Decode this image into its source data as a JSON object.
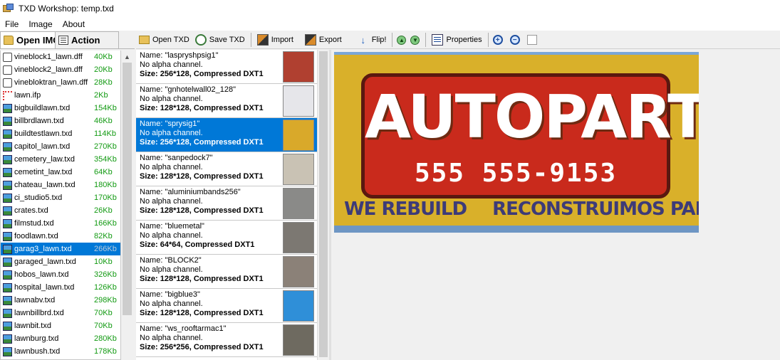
{
  "window": {
    "title": "TXD Workshop: temp.txd"
  },
  "menu": [
    "File",
    "Image",
    "About"
  ],
  "left_tabs": {
    "open": "Open IMG",
    "action": "Action"
  },
  "files": [
    {
      "name": "vineblock1_lawn.dff",
      "size": "40Kb",
      "icon": "dff-file-icon"
    },
    {
      "name": "vineblock2_lawn.dff",
      "size": "20Kb",
      "icon": "dff-file-icon"
    },
    {
      "name": "vinebloktran_lawn.dff",
      "size": "28Kb",
      "icon": "dff-file-icon"
    },
    {
      "name": "lawn.ifp",
      "size": "2Kb",
      "icon": "ifp-file-icon"
    },
    {
      "name": "bigbuildlawn.txd",
      "size": "154Kb",
      "icon": "txd-file-icon"
    },
    {
      "name": "billbrdlawn.txd",
      "size": "46Kb",
      "icon": "txd-file-icon"
    },
    {
      "name": "buildtestlawn.txd",
      "size": "114Kb",
      "icon": "txd-file-icon"
    },
    {
      "name": "capitol_lawn.txd",
      "size": "270Kb",
      "icon": "txd-file-icon"
    },
    {
      "name": "cemetery_law.txd",
      "size": "354Kb",
      "icon": "txd-file-icon"
    },
    {
      "name": "cemetint_law.txd",
      "size": "64Kb",
      "icon": "txd-file-icon"
    },
    {
      "name": "chateau_lawn.txd",
      "size": "180Kb",
      "icon": "txd-file-icon"
    },
    {
      "name": "ci_studio5.txd",
      "size": "170Kb",
      "icon": "txd-file-icon"
    },
    {
      "name": "crates.txd",
      "size": "26Kb",
      "icon": "txd-file-icon"
    },
    {
      "name": "filmstud.txd",
      "size": "166Kb",
      "icon": "txd-file-icon"
    },
    {
      "name": "foodlawn.txd",
      "size": "82Kb",
      "icon": "txd-file-icon"
    },
    {
      "name": "garag3_lawn.txd",
      "size": "266Kb",
      "icon": "txd-file-icon",
      "selected": true
    },
    {
      "name": "garaged_lawn.txd",
      "size": "10Kb",
      "icon": "txd-file-icon"
    },
    {
      "name": "hobos_lawn.txd",
      "size": "326Kb",
      "icon": "txd-file-icon"
    },
    {
      "name": "hospital_lawn.txd",
      "size": "126Kb",
      "icon": "txd-file-icon"
    },
    {
      "name": "lawnabv.txd",
      "size": "298Kb",
      "icon": "txd-file-icon"
    },
    {
      "name": "lawnbillbrd.txd",
      "size": "70Kb",
      "icon": "txd-file-icon"
    },
    {
      "name": "lawnbit.txd",
      "size": "70Kb",
      "icon": "txd-file-icon"
    },
    {
      "name": "lawnburg.txd",
      "size": "280Kb",
      "icon": "txd-file-icon"
    },
    {
      "name": "lawnbush.txd",
      "size": "178Kb",
      "icon": "txd-file-icon"
    }
  ],
  "toolbar": {
    "open_txd": "Open TXD",
    "save_txd": "Save TXD",
    "import": "Import",
    "export": "Export",
    "flip": "Flip!",
    "properties": "Properties"
  },
  "textures": [
    {
      "name": "Name: \"laspryshpsig1\"",
      "alpha": "No alpha channel.",
      "size": "Size: 256*128, Compressed DXT1",
      "thumb_color": "#b04030"
    },
    {
      "name": "Name: \"gnhotelwall02_128\"",
      "alpha": "No alpha channel.",
      "size": "Size: 128*128, Compressed DXT1",
      "thumb_color": "#e6e6ea"
    },
    {
      "name": "Name: \"sprysig1\"",
      "alpha": "No alpha channel.",
      "size": "Size: 256*128, Compressed DXT1",
      "thumb_color": "#d9a92a",
      "selected": true
    },
    {
      "name": "Name: \"sanpedock7\"",
      "alpha": "No alpha channel.",
      "size": "Size: 128*128, Compressed DXT1",
      "thumb_color": "#c9c2b4"
    },
    {
      "name": "Name: \"aluminiumbands256\"",
      "alpha": "No alpha channel.",
      "size": "Size: 128*128, Compressed DXT1",
      "thumb_color": "#8a8a88"
    },
    {
      "name": "Name: \"bluemetal\"",
      "alpha": "No alpha channel.",
      "size": "Size: 64*64, Compressed DXT1",
      "thumb_color": "#7c7872"
    },
    {
      "name": "Name: \"BLOCK2\"",
      "alpha": "No alpha channel.",
      "size": "Size: 128*128, Compressed DXT1",
      "thumb_color": "#8b8178"
    },
    {
      "name": "Name: \"bigblue3\"",
      "alpha": "No alpha channel.",
      "size": "Size: 128*128, Compressed DXT1",
      "thumb_color": "#2f8fd8"
    },
    {
      "name": "Name: \"ws_rooftarmac1\"",
      "alpha": "No alpha channel.",
      "size": "Size: 256*256, Compressed DXT1",
      "thumb_color": "#6e6a60"
    }
  ],
  "preview": {
    "headline": "AUTOPARTS",
    "phone": "555 555-9153",
    "tagline_left": "WE REBUILD",
    "tagline_right": "RECONSTRUIMOS PARTES"
  },
  "colors": {
    "selection": "#0078d7",
    "file_size": "#129a12"
  }
}
